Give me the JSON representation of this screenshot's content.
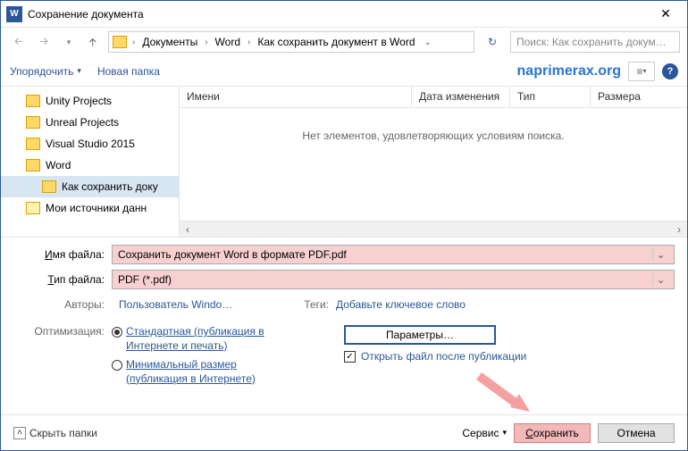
{
  "title": "Сохранение документа",
  "breadcrumbs": [
    "Документы",
    "Word",
    "Как сохранить документ в Word"
  ],
  "search_placeholder": "Поиск: Как сохранить докум…",
  "toolbar": {
    "organize": "Упорядочить",
    "new_folder": "Новая папка"
  },
  "watermark": "naprimerax.org",
  "tree": [
    {
      "name": "Unity Projects"
    },
    {
      "name": "Unreal Projects"
    },
    {
      "name": "Visual Studio 2015"
    },
    {
      "name": "Word"
    },
    {
      "name": "Как сохранить доку",
      "sub": true
    },
    {
      "name": "Мои источники данн",
      "src": true
    }
  ],
  "columns": {
    "name": "Имени",
    "date": "Дата изменения",
    "type": "Тип",
    "size": "Размера"
  },
  "empty_msg": "Нет элементов, удовлетворяющих условиям поиска.",
  "filename_label": "Имя файла:",
  "filetype_label": "Тип файла:",
  "filename": "Сохранить документ Word в формате PDF.pdf",
  "filetype": "PDF (*.pdf)",
  "authors_label": "Авторы:",
  "authors_value": "Пользователь Windo…",
  "tags_label": "Теги:",
  "tags_value": "Добавьте ключевое слово",
  "optimize_label": "Оптимизация:",
  "opt_standard": "Стандартная (публикация в Интернете и печать)",
  "opt_minimal": "Минимальный размер (публикация в Интернете)",
  "params_btn": "Параметры…",
  "open_after": "Открыть файл после публикации",
  "hide_folders": "Скрыть папки",
  "service": "Сервис",
  "save": "Сохранить",
  "cancel": "Отмена"
}
